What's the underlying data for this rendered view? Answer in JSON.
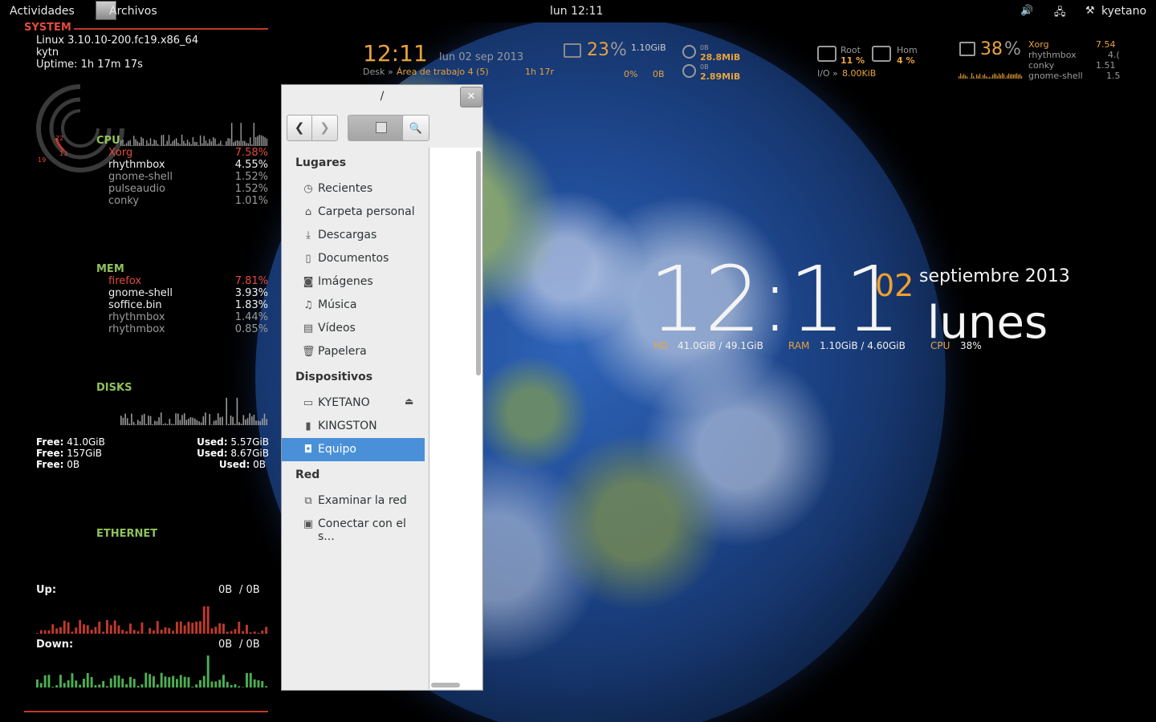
{
  "topbar": {
    "activities": "Actividades",
    "app_name": "Archivos",
    "clock": "lun 12:11",
    "volume_icon": "🔊",
    "network_icon": "🖧",
    "user_icon": "⚒",
    "user": "kyetano"
  },
  "system": {
    "heading": "SYSTEM",
    "kernel": "Linux 3.10.10-200.fc19.x86_64",
    "host": "kytn",
    "uptime": "Uptime: 1h 17m 17s",
    "gauge_labels": [
      "22",
      "13",
      "19"
    ]
  },
  "cpu": {
    "heading": "CPU",
    "procs": [
      {
        "name": "Xorg",
        "value": "7.58%"
      },
      {
        "name": "rhythmbox",
        "value": "4.55%"
      },
      {
        "name": "gnome-shell",
        "value": "1.52%"
      },
      {
        "name": "pulseaudio",
        "value": "1.52%"
      },
      {
        "name": "conky",
        "value": "1.01%"
      }
    ]
  },
  "mem": {
    "heading": "MEM",
    "procs": [
      {
        "name": "firefox",
        "value": "7.81%"
      },
      {
        "name": "gnome-shell",
        "value": "3.93%"
      },
      {
        "name": "soffice.bin",
        "value": "1.83%"
      },
      {
        "name": "rhythmbox",
        "value": "1.44%"
      },
      {
        "name": "rhythmbox",
        "value": "0.85%"
      }
    ]
  },
  "disks": {
    "heading": "DISKS",
    "rows": [
      {
        "free_label": "Free:",
        "free": "41.0GiB",
        "used_label": "Used:",
        "used": "5.57GiB"
      },
      {
        "free_label": "Free:",
        "free": "157GiB",
        "used_label": "Used:",
        "used": "8.67GiB"
      },
      {
        "free_label": "Free:",
        "free": "0B",
        "used_label": "Used:",
        "used": "0B"
      }
    ]
  },
  "ethernet": {
    "heading": "ETHERNET",
    "up_label": "Up:",
    "up_value": "0B",
    "up_total": "/ 0B",
    "down_label": "Down:",
    "down_value": "0B",
    "down_total": "/ 0B"
  },
  "top_widgets": {
    "time": "12:11",
    "date": "lun 02 sep 2013",
    "desk_label": "Desk",
    "desk_sep": "»",
    "desk_value": "Área de trabajo 4 (5)",
    "uptime_short": "1h 17r",
    "ram_percent": "23",
    "ram_unit": "%",
    "ram_used": "1.10GiB",
    "swap_percent": "0%",
    "swap_used": "0B",
    "down_label": "0B",
    "down_value": "28.8MiB",
    "up_label": "0B",
    "up_value": "2.89MiB",
    "root_label": "Root",
    "root_value": "11 %",
    "home_label": "Hom",
    "home_value": "4 %",
    "io_label": "I/O",
    "io_sep": "»",
    "io_value": "8.00KiB",
    "cpu_percent": "38",
    "cpu_unit": "%",
    "top_procs": [
      {
        "name": "Xorg",
        "value": "7.54"
      },
      {
        "name": "rhythmbox",
        "value": "4.("
      },
      {
        "name": "conky",
        "value": "1.51"
      },
      {
        "name": "gnome-shell",
        "value": "1.5"
      }
    ]
  },
  "big_clock": {
    "time": "12:11",
    "day": "02",
    "month_year": "septiembre 2013",
    "weekday": "lunes",
    "hd_label": "HD",
    "hd_value": "41.0GiB / 49.1GiB",
    "ram_label": "RAM",
    "ram_value": "1.10GiB / 4.60GiB",
    "cpu_label": "CPU",
    "cpu_value": "38%"
  },
  "file_chooser": {
    "title": "/",
    "close": "✕",
    "back": "❮",
    "forward": "❯",
    "search": "🔍",
    "places_heading": "Lugares",
    "places": [
      {
        "icon": "◷",
        "label": "Recientes"
      },
      {
        "icon": "⌂",
        "label": "Carpeta personal"
      },
      {
        "icon": "⤓",
        "label": "Descargas"
      },
      {
        "icon": "▯",
        "label": "Documentos"
      },
      {
        "icon": "◙",
        "label": "Imágenes"
      },
      {
        "icon": "♫",
        "label": "Música"
      },
      {
        "icon": "▤",
        "label": "Vídeos"
      },
      {
        "icon": "🗑",
        "label": "Papelera"
      }
    ],
    "devices_heading": "Dispositivos",
    "devices": [
      {
        "icon": "▭",
        "label": "KYETANO"
      },
      {
        "icon": "▮",
        "label": "KINGSTON"
      },
      {
        "icon": "◘",
        "label": "Equipo"
      }
    ],
    "eject": "⏏",
    "network_heading": "Red",
    "network": [
      {
        "icon": "⧉",
        "label": "Examinar la red"
      },
      {
        "icon": "▣",
        "label": "Conectar con el s..."
      }
    ]
  },
  "colors": {
    "accent_red": "#e34b3b",
    "accent_green": "#8fc25b",
    "accent_orange": "#e8a33c",
    "selection_blue": "#4a90d9"
  }
}
